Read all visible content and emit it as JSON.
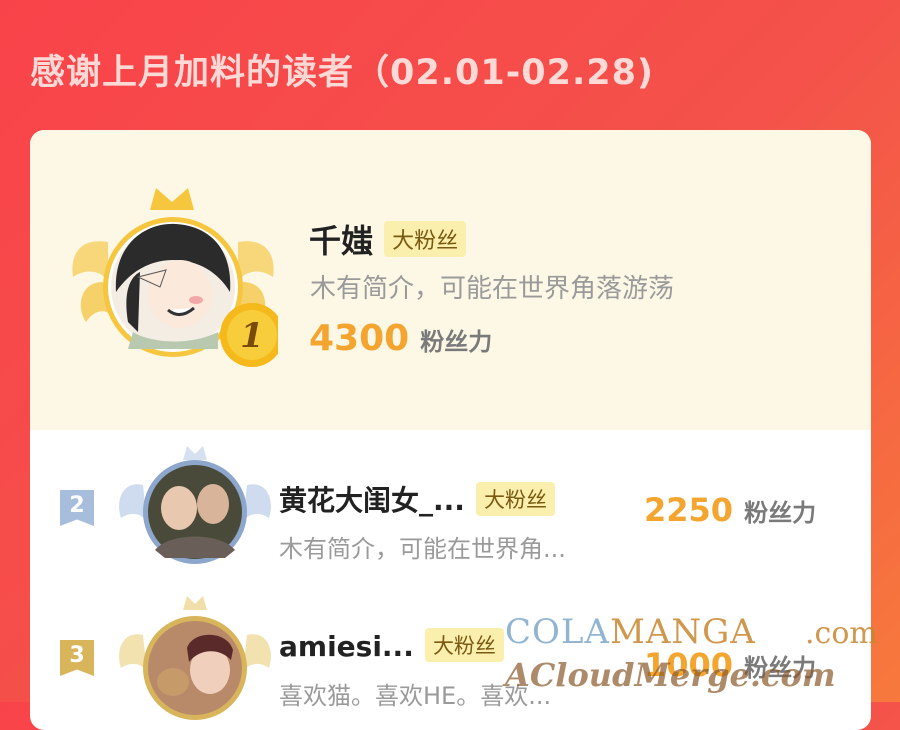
{
  "header": {
    "title": "感谢上月加料的读者（02.01-02.28)"
  },
  "readers": [
    {
      "rank": "1",
      "name": "千媸",
      "badge": "大粉丝",
      "bio": "木有简介，可能在世界角落游荡",
      "score": "4300",
      "unit": "粉丝力"
    },
    {
      "rank": "2",
      "name": "黄花大闺女_...",
      "badge": "大粉丝",
      "bio": "木有简介，可能在世界角...",
      "score": "2250",
      "unit": "粉丝力"
    },
    {
      "rank": "3",
      "name": "amiesi...",
      "badge": "大粉丝",
      "bio": "喜欢猫。喜欢HE。喜欢...",
      "score": "1000",
      "unit": "粉丝力"
    }
  ],
  "watermark": {
    "line1a": "COLA",
    "line1b": "MANGA",
    "line1c": ".com",
    "line2": "ACloudMerge.com"
  },
  "colors": {
    "background": "#f6494a",
    "gold": "#f3a52f",
    "badge": "#fbefae",
    "silver": "#9fb5d6",
    "bronze": "#d8b45a"
  }
}
